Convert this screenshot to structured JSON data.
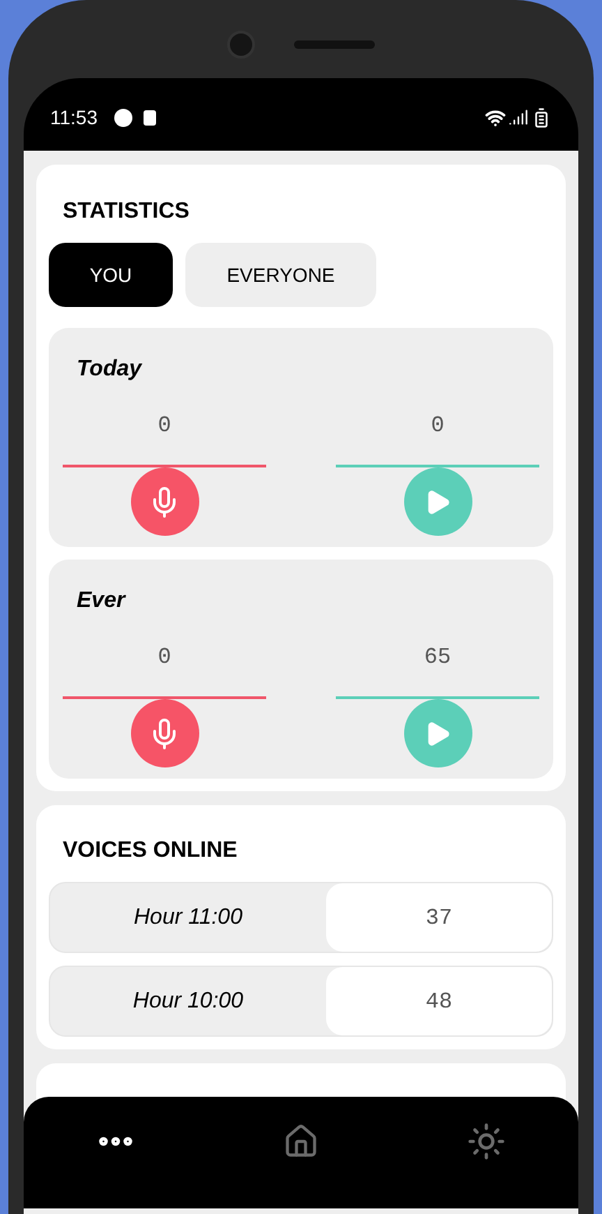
{
  "status_bar": {
    "time": "11:53"
  },
  "statistics": {
    "title": "STATISTICS",
    "tabs": [
      {
        "label": "YOU",
        "selected": true
      },
      {
        "label": "EVERYONE",
        "selected": false
      }
    ],
    "periods": [
      {
        "title": "Today",
        "recorded": "0",
        "listened": "0"
      },
      {
        "title": "Ever",
        "recorded": "0",
        "listened": "65"
      }
    ]
  },
  "voices_online": {
    "title": "VOICES ONLINE",
    "rows": [
      {
        "label": "Hour 11:00",
        "value": "37"
      },
      {
        "label": "Hour 10:00",
        "value": "48"
      }
    ]
  },
  "bottom_nav": [
    {
      "kind": "more",
      "selected": true
    },
    {
      "kind": "home",
      "selected": false
    },
    {
      "kind": "settings",
      "selected": false
    }
  ]
}
